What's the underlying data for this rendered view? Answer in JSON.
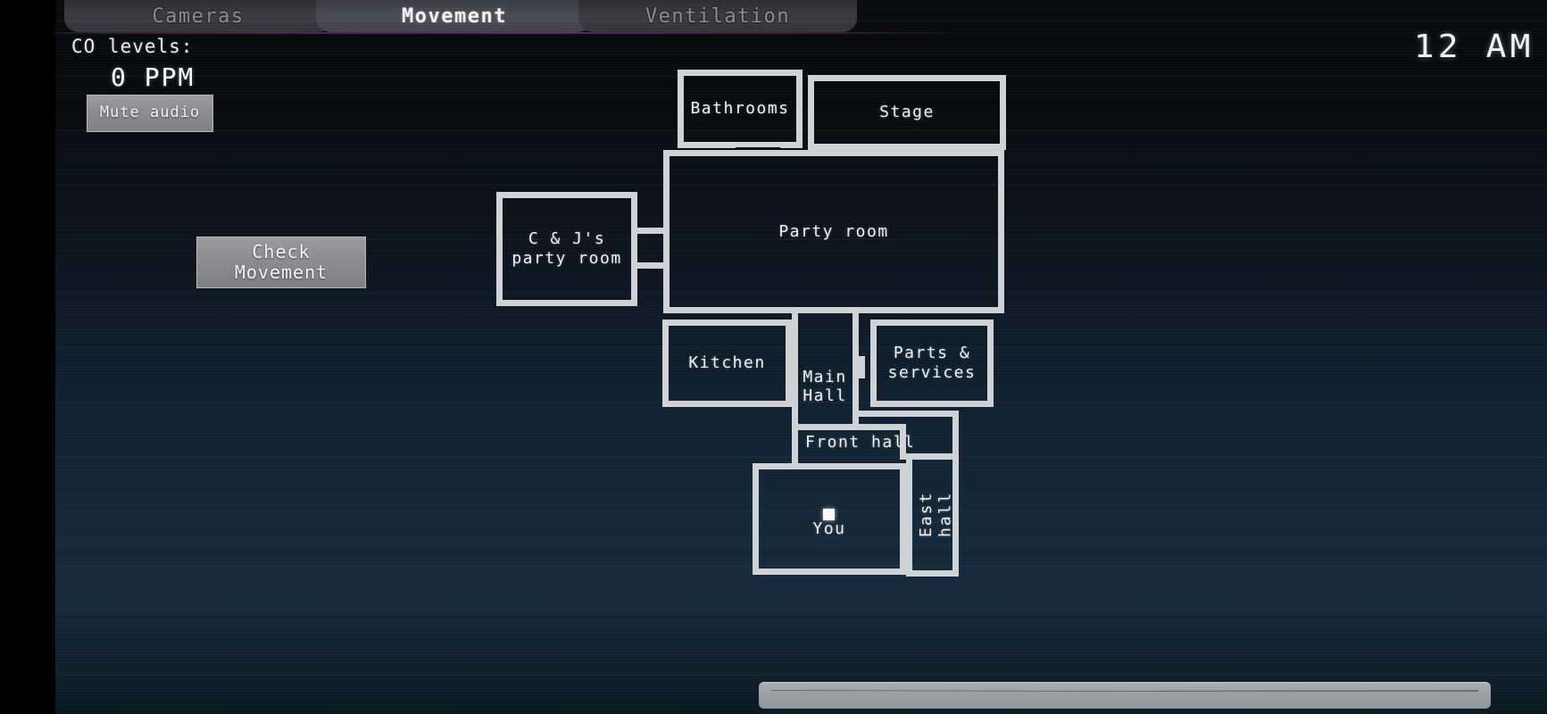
{
  "tabs": [
    {
      "id": "cameras",
      "label": "Cameras",
      "active": false
    },
    {
      "id": "movement",
      "label": "Movement",
      "active": true
    },
    {
      "id": "ventilation",
      "label": "Ventilation",
      "active": false
    }
  ],
  "hud": {
    "co_label": "CO levels:",
    "co_value": "0 PPM",
    "mute_button": "Mute audio",
    "check_button_line1": "Check",
    "check_button_line2": "Movement",
    "clock": "12 AM"
  },
  "map": {
    "rooms": [
      {
        "id": "bathrooms",
        "label": "Bathrooms"
      },
      {
        "id": "stage",
        "label": "Stage"
      },
      {
        "id": "party-room",
        "label": "Party room"
      },
      {
        "id": "cj-party-room",
        "label": "C & J's\nparty room"
      },
      {
        "id": "kitchen",
        "label": "Kitchen"
      },
      {
        "id": "parts-services",
        "label": "Parts &\nservices"
      },
      {
        "id": "player-room",
        "label": "You"
      }
    ],
    "halls": [
      {
        "id": "main-hall",
        "label": "Main\nHall"
      },
      {
        "id": "front-hall",
        "label": "Front hall"
      },
      {
        "id": "east-hall",
        "label": "East hall"
      }
    ],
    "player_marker": "you-marker"
  },
  "colors": {
    "wall": "#cfd2d4",
    "text": "#eef1f3",
    "tab_accent": "#5d2468",
    "background_top": "#070a0c",
    "background_bottom": "#183041",
    "button_face": "#8b8b90"
  }
}
